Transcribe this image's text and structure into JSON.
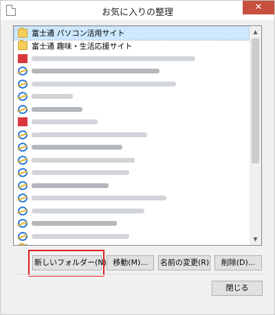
{
  "window": {
    "title": "お気に入りの整理",
    "close_glyph": "✕"
  },
  "favorites": [
    {
      "kind": "folder",
      "label": "富士通 パソコン活用サイト",
      "selected": true
    },
    {
      "kind": "folder",
      "label": "富士通 趣味・生活応援サイト",
      "selected": false
    },
    {
      "kind": "red",
      "blurred": true
    },
    {
      "kind": "ie",
      "blurred": true
    },
    {
      "kind": "ie",
      "blurred": true
    },
    {
      "kind": "ie",
      "blurred": true
    },
    {
      "kind": "ie",
      "blurred": true
    },
    {
      "kind": "red",
      "blurred": true
    },
    {
      "kind": "ie",
      "blurred": true
    },
    {
      "kind": "ie",
      "blurred": true
    },
    {
      "kind": "ie",
      "blurred": true
    },
    {
      "kind": "ie",
      "blurred": true
    },
    {
      "kind": "ie",
      "blurred": true
    },
    {
      "kind": "ie",
      "blurred": true
    },
    {
      "kind": "ie",
      "blurred": true
    },
    {
      "kind": "ie",
      "blurred": true
    },
    {
      "kind": "ie",
      "blurred": true
    },
    {
      "kind": "folder",
      "blurred": true
    },
    {
      "kind": "folder",
      "blurred": true
    }
  ],
  "buttons": {
    "new_folder": "新しいフォルダー(N)",
    "move": "移動(M)...",
    "rename": "名前の変更(R)",
    "delete": "削除(D)...",
    "close": "閉じる"
  },
  "colors": {
    "highlight": "#e0191a",
    "close_button": "#c7503f",
    "selection": "#cde8ff"
  }
}
